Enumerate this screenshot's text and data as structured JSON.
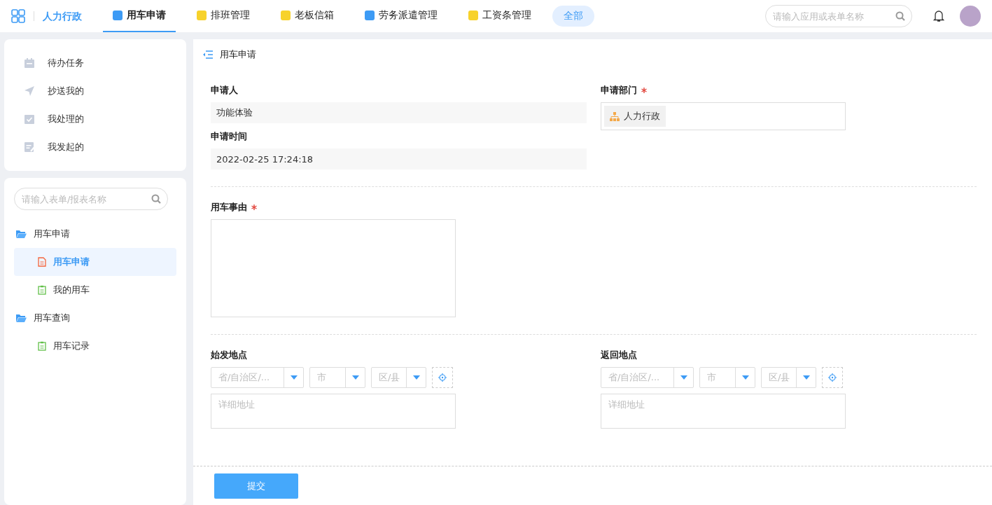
{
  "header": {
    "app_name": "人力行政",
    "tabs": [
      {
        "label": "用车申请",
        "selected": true,
        "color": "#3d9bf5"
      },
      {
        "label": "排班管理",
        "selected": false,
        "color": "#f7d22b"
      },
      {
        "label": "老板信箱",
        "selected": false,
        "color": "#f7d22b"
      },
      {
        "label": "劳务派遣管理",
        "selected": false,
        "color": "#3d9bf5"
      },
      {
        "label": "工资条管理",
        "selected": false,
        "color": "#f7d22b"
      }
    ],
    "all_button": "全部",
    "search": {
      "placeholder": "请输入应用或表单名称"
    }
  },
  "sidebar": {
    "quick_items": [
      {
        "label": "待办任务",
        "kind": "calendar"
      },
      {
        "label": "抄送我的",
        "kind": "send"
      },
      {
        "label": "我处理的",
        "kind": "done"
      },
      {
        "label": "我发起的",
        "kind": "edit"
      }
    ],
    "search": {
      "placeholder": "请输入表单/报表名称"
    },
    "tree": [
      {
        "label": "用车申请",
        "expanded": true,
        "children": [
          {
            "label": "用车申请",
            "selected": true
          },
          {
            "label": "我的用车",
            "selected": false
          }
        ]
      },
      {
        "label": "用车查询",
        "expanded": true,
        "children": [
          {
            "label": "用车记录",
            "selected": false
          }
        ]
      }
    ]
  },
  "form": {
    "title": "用车申请",
    "sections": [
      {
        "fields": [
          {
            "kind": "readonly",
            "label": "申请人",
            "required": false,
            "value": "功能体验"
          },
          {
            "kind": "department",
            "label": "申请部门",
            "required": true,
            "value": "人力行政"
          },
          {
            "kind": "readonly",
            "label": "申请时间",
            "required": false,
            "value": "2022-02-25 17:24:18"
          }
        ]
      },
      {
        "fields": [
          {
            "kind": "textarea",
            "label": "用车事由",
            "required": true
          }
        ]
      },
      {
        "fields": [
          {
            "kind": "address",
            "label": "始发地点",
            "required": false,
            "selects": [
              "省/自治区/...",
              "市",
              "区/县"
            ],
            "placeholder": "详细地址"
          },
          {
            "kind": "address",
            "label": "返回地点",
            "required": false,
            "selects": [
              "省/自治区/...",
              "市",
              "区/县"
            ],
            "placeholder": "详细地址"
          }
        ]
      }
    ],
    "submit": "提交"
  }
}
